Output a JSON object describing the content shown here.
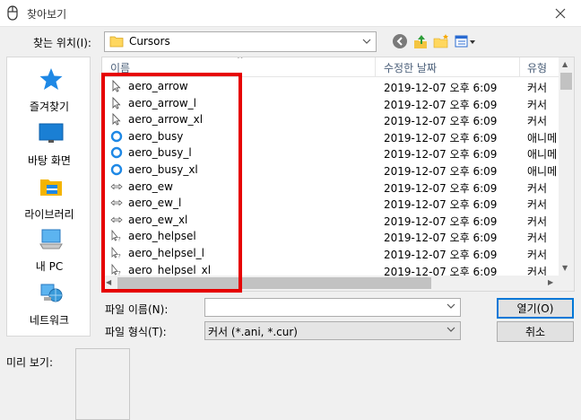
{
  "window": {
    "title": "찾아보기"
  },
  "lookin": {
    "label": "찾는 위치(I):",
    "value": "Cursors"
  },
  "places": [
    {
      "label": "즐겨찾기",
      "icon": "star-icon"
    },
    {
      "label": "바탕 화면",
      "icon": "desktop-icon"
    },
    {
      "label": "라이브러리",
      "icon": "library-icon"
    },
    {
      "label": "내 PC",
      "icon": "computer-icon"
    },
    {
      "label": "네트워크",
      "icon": "network-icon"
    }
  ],
  "columns": {
    "name": "이름",
    "date": "수정한 날짜",
    "type": "유형"
  },
  "files": [
    {
      "name": "aero_arrow",
      "date": "2019-12-07 오후 6:09",
      "type": "커서",
      "icon": "arrow"
    },
    {
      "name": "aero_arrow_l",
      "date": "2019-12-07 오후 6:09",
      "type": "커서",
      "icon": "arrow"
    },
    {
      "name": "aero_arrow_xl",
      "date": "2019-12-07 오후 6:09",
      "type": "커서",
      "icon": "arrow"
    },
    {
      "name": "aero_busy",
      "date": "2019-12-07 오후 6:09",
      "type": "애니메",
      "icon": "busy"
    },
    {
      "name": "aero_busy_l",
      "date": "2019-12-07 오후 6:09",
      "type": "애니메",
      "icon": "busy"
    },
    {
      "name": "aero_busy_xl",
      "date": "2019-12-07 오후 6:09",
      "type": "애니메",
      "icon": "busy"
    },
    {
      "name": "aero_ew",
      "date": "2019-12-07 오후 6:09",
      "type": "커서",
      "icon": "ew"
    },
    {
      "name": "aero_ew_l",
      "date": "2019-12-07 오후 6:09",
      "type": "커서",
      "icon": "ew"
    },
    {
      "name": "aero_ew_xl",
      "date": "2019-12-07 오후 6:09",
      "type": "커서",
      "icon": "ew"
    },
    {
      "name": "aero_helpsel",
      "date": "2019-12-07 오후 6:09",
      "type": "커서",
      "icon": "help"
    },
    {
      "name": "aero_helpsel_l",
      "date": "2019-12-07 오후 6:09",
      "type": "커서",
      "icon": "help"
    },
    {
      "name": "aero_helpsel_xl",
      "date": "2019-12-07 오후 6:09",
      "type": "커서",
      "icon": "help"
    }
  ],
  "filename": {
    "label": "파일 이름(N):",
    "value": ""
  },
  "filetype": {
    "label": "파일 형식(T):",
    "value": "커서 (*.ani, *.cur)"
  },
  "buttons": {
    "open": "열기(O)",
    "cancel": "취소"
  },
  "preview": {
    "label": "미리 보기:"
  },
  "colors": {
    "highlight": "#e60000",
    "accent": "#0078d7",
    "busy": "#1e88e5"
  }
}
